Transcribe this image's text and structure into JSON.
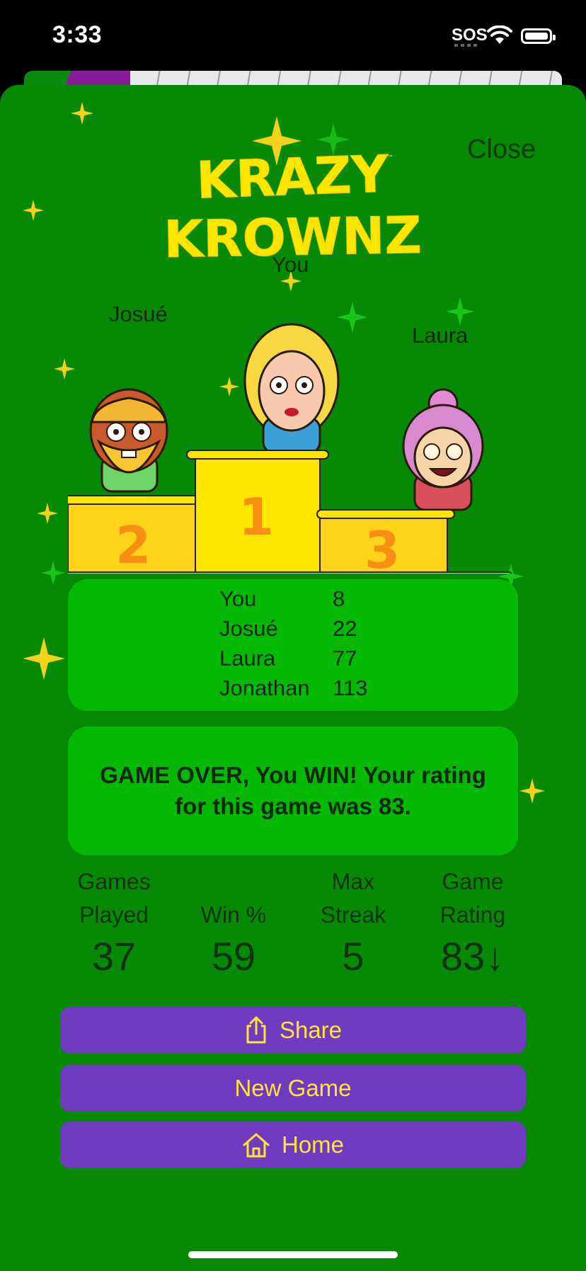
{
  "status": {
    "time": "3:33",
    "carrier": "SOS"
  },
  "header": {
    "close_label": "Close",
    "logo_line1": "KRAZY",
    "logo_line2": "KROWNZ",
    "logo_tm": "™"
  },
  "podium": [
    {
      "rank": "1",
      "name": "You"
    },
    {
      "rank": "2",
      "name": "Josué"
    },
    {
      "rank": "3",
      "name": "Laura"
    }
  ],
  "scores": [
    {
      "player": "You",
      "score": "8"
    },
    {
      "player": "Josué",
      "score": "22"
    },
    {
      "player": "Laura",
      "score": "77"
    },
    {
      "player": "Jonathan",
      "score": "113"
    }
  ],
  "message": "GAME OVER, You WIN! Your rating for this game was 83.",
  "stats": [
    {
      "label_line1": "Games",
      "label_line2": "Played",
      "value": "37"
    },
    {
      "label_line1": "",
      "label_line2": "Win %",
      "value": "59"
    },
    {
      "label_line1": "Max",
      "label_line2": "Streak",
      "value": "5"
    },
    {
      "label_line1": "Game",
      "label_line2": "Rating",
      "value": "83↓"
    }
  ],
  "buttons": {
    "share": "Share",
    "new_game": "New Game",
    "home": "Home"
  },
  "colors": {
    "background": "#068a06",
    "panel": "#04b804",
    "button": "#6f3bc0",
    "button_text": "#ffe43a",
    "podium": "#ffe600"
  },
  "icons": {
    "share": "share-icon",
    "home": "home-icon"
  }
}
